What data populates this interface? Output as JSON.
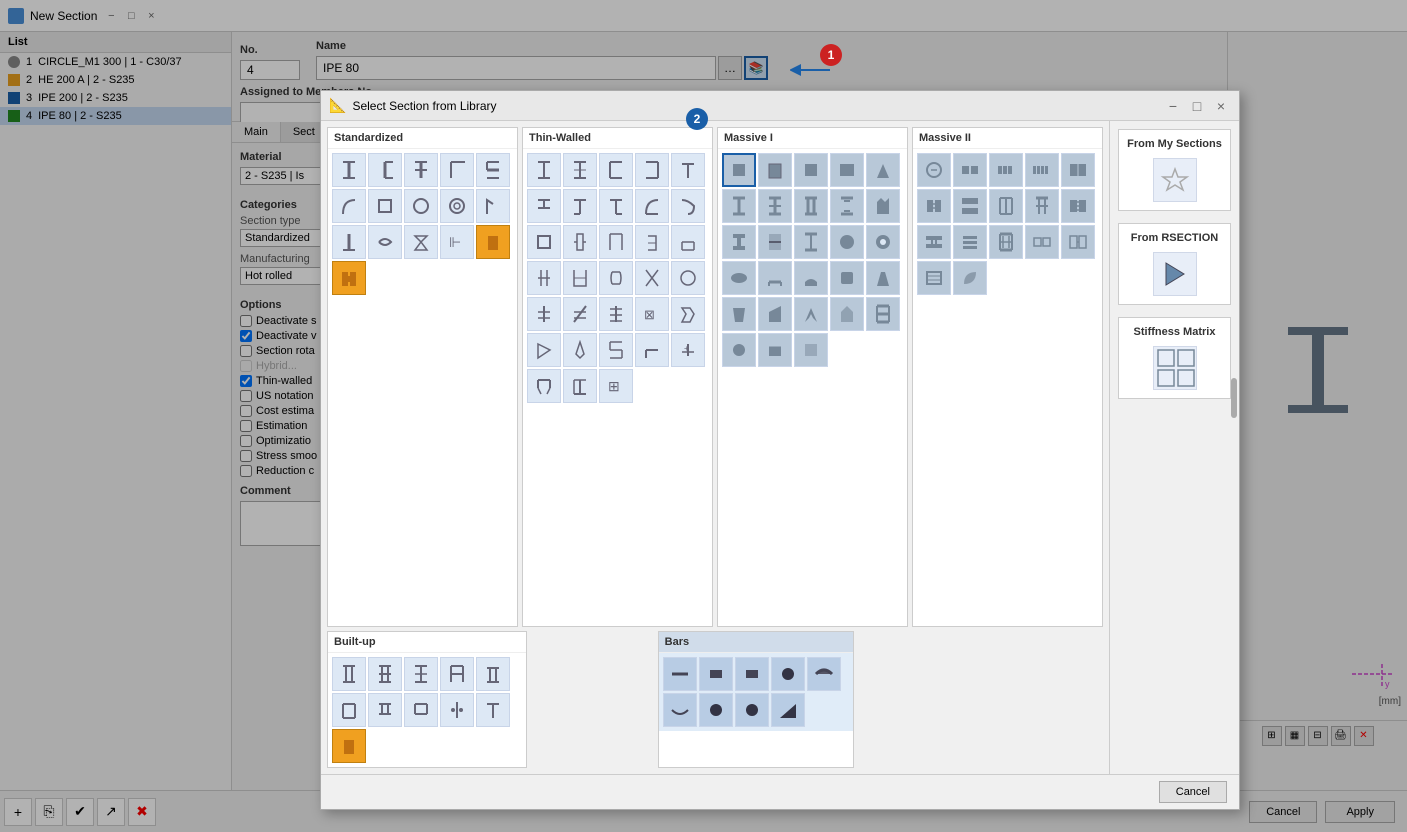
{
  "window": {
    "title": "New Section",
    "close_btn": "×",
    "maximize_btn": "□",
    "minimize_btn": "−"
  },
  "list_panel": {
    "header": "List",
    "items": [
      {
        "id": 1,
        "color": "#888888",
        "color_type": "circle",
        "text": "CIRCLE_M1 300 | 1 - C30/37"
      },
      {
        "id": 2,
        "color": "#e8a020",
        "color_type": "rect",
        "text": "HE 200 A | 2 - S235"
      },
      {
        "id": 3,
        "color": "#1a5fa8",
        "color_type": "rect",
        "text": "IPE 200 | 2 - S235"
      },
      {
        "id": 4,
        "color": "#228822",
        "color_type": "rect",
        "text": "IPE 80 | 2 - S235",
        "selected": true
      }
    ]
  },
  "form": {
    "no_label": "No.",
    "no_value": "4",
    "name_label": "Name",
    "name_value": "IPE 80",
    "assigned_label": "Assigned to Members No.",
    "tabs": [
      "Main",
      "Sect"
    ],
    "material_label": "Material",
    "material_value": "2 - S235 | Is",
    "categories_label": "Categories",
    "section_type_label": "Section type",
    "section_type_value": "Standardized",
    "manufacturing_label": "Manufacturing",
    "manufacturing_value": "Hot rolled",
    "options_label": "Options",
    "checkboxes": [
      {
        "label": "Deactivate s",
        "checked": false
      },
      {
        "label": "Deactivate v",
        "checked": true
      },
      {
        "label": "Section rota",
        "checked": false
      },
      {
        "label": "Hybrid...",
        "checked": false,
        "disabled": true
      },
      {
        "label": "Thin-walled",
        "checked": true
      },
      {
        "label": "US notation",
        "checked": false
      },
      {
        "label": "Cost estima",
        "checked": false
      },
      {
        "label": "Estimation",
        "checked": false
      },
      {
        "label": "Optimizatio",
        "checked": false
      },
      {
        "label": "Stress smoo",
        "checked": false
      },
      {
        "label": "Reduction c",
        "checked": false
      }
    ],
    "comment_label": "Comment"
  },
  "modal": {
    "title": "Select Section from Library",
    "badge1": "1",
    "badge2": "2",
    "close_btn": "×",
    "maximize_btn": "□",
    "minimize_btn": "−",
    "cancel_btn": "Cancel",
    "categories": {
      "standardized": {
        "title": "Standardized",
        "icons": [
          "I",
          "⊣",
          "T",
          "L",
          "⊤",
          "ζ",
          "□",
          "○",
          "θ",
          "⌐",
          "⊥",
          "∿",
          "⊸",
          "⊸",
          "⊕",
          "∓",
          "⊸",
          "⊸",
          "⊩",
          "⊔",
          "▮",
          "▦"
        ]
      },
      "buildup": {
        "title": "Built-up",
        "icons": [
          "⊩",
          "⊢",
          "⊤",
          "⊣",
          "⊤",
          "⊢",
          "⊣",
          "⊢",
          "⊔",
          "••",
          "⊔",
          "▮"
        ]
      },
      "thinwalled": {
        "title": "Thin-Walled",
        "icons_rows": 12
      },
      "massive1": {
        "title": "Massive I",
        "icons_rows": 10
      },
      "massive2": {
        "title": "Massive II",
        "icons_rows": 8
      },
      "bars": {
        "title": "Bars",
        "icons": [
          "—",
          "■",
          "■",
          "●",
          "◗",
          "—",
          "●",
          "●",
          "◢"
        ]
      }
    },
    "side_panel": {
      "from_sections": {
        "title": "From My Sections",
        "icon": "★"
      },
      "from_rsection": {
        "title": "From RSECTION",
        "icon": "▶"
      },
      "stiffness_matrix": {
        "title": "Stiffness Matrix",
        "icon": "⊞"
      }
    }
  },
  "bottom_bar": {
    "cancel_btn": "Cancel",
    "apply_btn": "Apply"
  },
  "mm_label": "[mm]",
  "axes": {
    "y_label": "y"
  }
}
